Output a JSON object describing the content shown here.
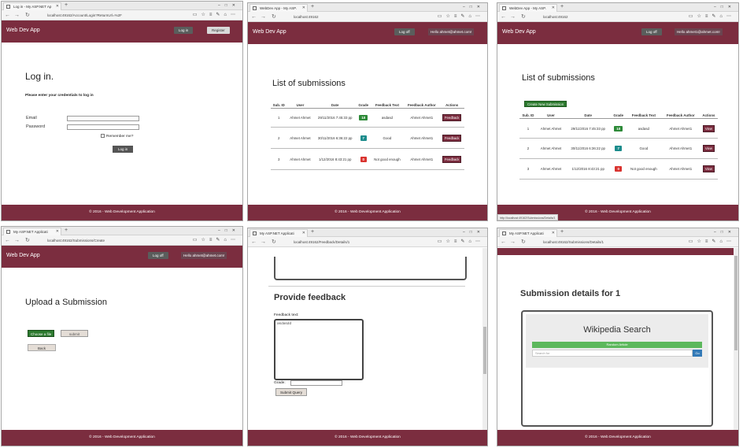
{
  "panels": {
    "login": {
      "tab_title": "Log in - My ASP.NET Ap",
      "url": "localhost:49162/Account/Login?ReturnUrl=%2F",
      "brand": "Web Dev App",
      "nav_login": "Log in",
      "nav_register": "Register",
      "title": "Log in.",
      "subtitle": "Please enter your credentials to log in",
      "email_label": "Email",
      "password_label": "Password",
      "remember_label": "Remember me?",
      "submit_label": "Log in",
      "footer": "© 2016 - Web Development Application"
    },
    "list1": {
      "tab_title": "WebDev App - My ASP.",
      "url": "localhost:49162",
      "brand": "Web Dev App",
      "nav_logoff": "Log off",
      "nav_hello": "Hello ahmet@ahmet.com!",
      "title": "List of submissions",
      "headers": [
        "Sub. ID",
        "User",
        "Date",
        "Grade",
        "Feedback Text",
        "Feedback Author",
        "Actions"
      ],
      "rows": [
        {
          "id": "1",
          "user": "Ahmet Ahmet",
          "date": "29/11/2016 7:45:33 pp",
          "grade": "10",
          "text": "asdasd",
          "author": "Ahmet Ahmet1",
          "action": "Feedback"
        },
        {
          "id": "2",
          "user": "Ahmet Ahmet",
          "date": "30/11/2016 6:36:22 pp",
          "grade": "7",
          "text": "Good",
          "author": "Ahmet Ahmet1",
          "action": "Feedback"
        },
        {
          "id": "3",
          "user": "Ahmet Ahmet",
          "date": "1/12/2016 8:43:21 pp",
          "grade": "0",
          "text": "Not good enough",
          "author": "Ahmet Ahmet1",
          "action": "Feedback"
        }
      ],
      "footer": "© 2016 - Web Development Application"
    },
    "list2": {
      "tab_title": "WebDev App - My ASP.",
      "url": "localhost:49162",
      "brand": "Web Dev App",
      "nav_logoff": "Log off",
      "nav_hello": "Hello ahmet1@ahmet.com!",
      "title": "List of submissions",
      "create_label": "Create New Submission",
      "headers": [
        "Sub. ID",
        "User",
        "Date",
        "Grade",
        "Feedback Text",
        "Feedback Author",
        "Actions"
      ],
      "rows": [
        {
          "id": "1",
          "user": "Ahmet Ahmet",
          "date": "29/11/2016 7:45:33 pp",
          "grade": "10",
          "text": "asdasd",
          "author": "Ahmet Ahmet1",
          "action": "View"
        },
        {
          "id": "2",
          "user": "Ahmet Ahmet",
          "date": "30/11/2016 6:36:22 pp",
          "grade": "7",
          "text": "Good",
          "author": "Ahmet Ahmet1",
          "action": "View"
        },
        {
          "id": "3",
          "user": "Ahmet Ahmet",
          "date": "1/12/2016 8:43:21 pp",
          "grade": "0",
          "text": "Not good enough",
          "author": "Ahmet Ahmet1",
          "action": "View"
        }
      ],
      "status_url": "http://localhost:49162/Submissions/Details/1",
      "footer": "© 2016 - Web Development Application"
    },
    "upload": {
      "tab_title": "My ASP.NET Applicati",
      "url": "localhost:49162/Submissions/Create",
      "brand": "Web Dev App",
      "nav_logoff": "Log off",
      "nav_hello": "Hello ahmet@ahmet.com!",
      "title": "Upload a Submission",
      "choose_label": "Choose a file",
      "submit_label": "submit",
      "back_label": "Back",
      "footer": "© 2016 - Web Development Application"
    },
    "feedback": {
      "tab_title": "My ASP.NET Applicati",
      "url": "localhost:49162/Feedback/Details/1",
      "title": "Provide feedback",
      "text_label": "Feedback text:",
      "text_value": "asdasdd",
      "grade_label": "Grade:",
      "submit_label": "Submit Query",
      "footer": "© 2016 - Web Development Application"
    },
    "details": {
      "tab_title": "My ASP.NET Applicati",
      "url": "localhost:49162/Submissions/Details/1",
      "title": "Submission details for 1",
      "wiki_title": "Wikipedia Search",
      "random_label": "Random Article",
      "search_placeholder": "Search for",
      "go_label": "Go",
      "footer": "© 2016 - Web Development Application"
    }
  },
  "colors": {
    "navbar": "#7b2d3f",
    "grade_high": "#2d8a38",
    "grade_mid": "#1c8c8c",
    "grade_low": "#d9332f"
  }
}
